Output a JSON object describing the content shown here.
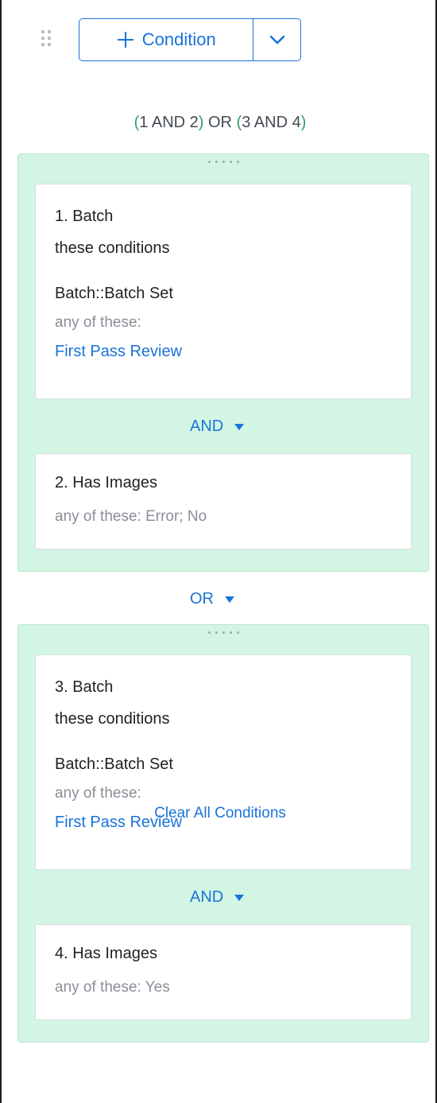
{
  "toolbar": {
    "add_condition_label": "Condition",
    "icons": {
      "drag": "drag-handle-icon",
      "add": "plus-icon",
      "more": "chevron-down-icon"
    }
  },
  "logic": {
    "open1": "(",
    "group1": "1 AND 2",
    "close1": ")",
    "joiner": " OR ",
    "open2": "(",
    "group2": "3 AND 4",
    "close2": ")"
  },
  "groups": [
    {
      "conditions": [
        {
          "title": "1. Batch",
          "subtitle": "these conditions",
          "field": "Batch::Batch Set",
          "operator": "any of these:",
          "value": "First Pass Review"
        },
        {
          "title": "2. Has Images",
          "detail": "any of these: Error; No"
        }
      ],
      "inner_operator": "AND"
    },
    {
      "conditions": [
        {
          "title": "3. Batch",
          "subtitle": "these conditions",
          "field": "Batch::Batch Set",
          "operator": "any of these:",
          "value": "First Pass Review"
        },
        {
          "title": "4. Has Images",
          "detail": "any of these: Yes"
        }
      ],
      "inner_operator": "AND"
    }
  ],
  "group_operator": "OR",
  "footer": {
    "clear_all_label": "Clear All Conditions"
  },
  "colors": {
    "accent": "#1a73d8",
    "group_bg": "#d3f5e3",
    "paren_green": "#2e9e66",
    "muted_text": "#8a8f98"
  }
}
